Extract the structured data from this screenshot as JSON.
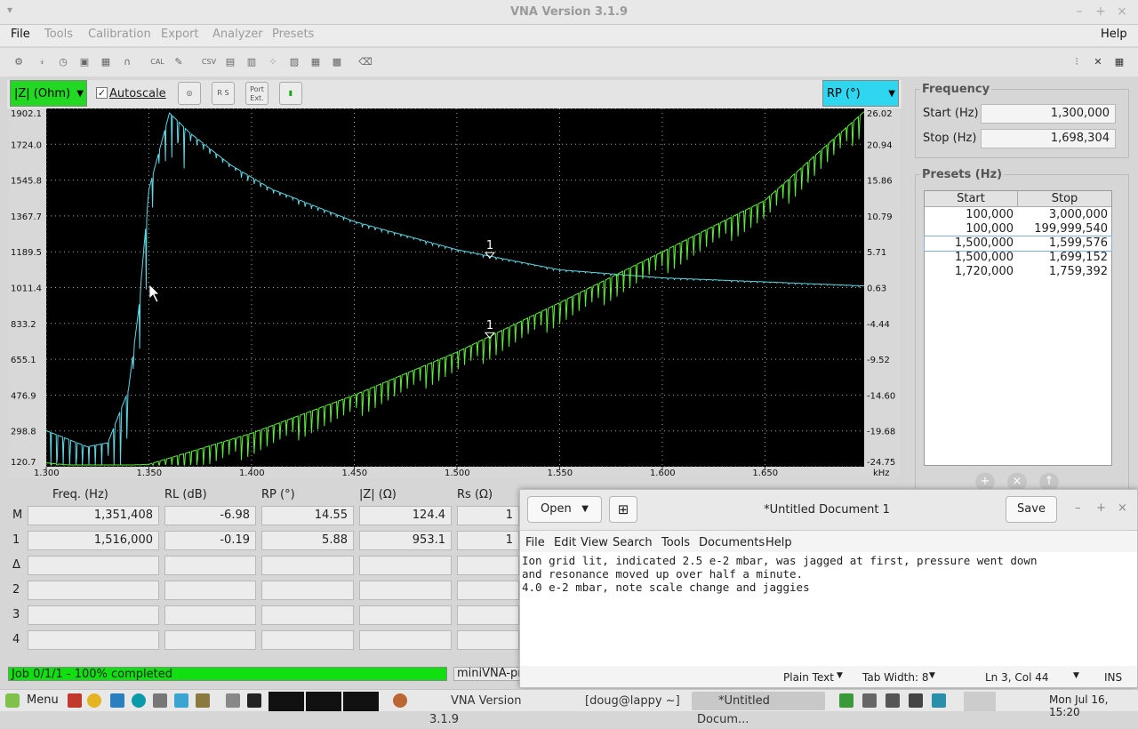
{
  "window": {
    "title": "VNA Version 3.1.9",
    "min": "–",
    "max": "+",
    "close": "×",
    "menu_icon": "▾"
  },
  "menu": {
    "file": "File",
    "tools": "Tools",
    "calibration": "Calibration",
    "export": "Export",
    "analyzer": "Analyzer",
    "presets": "Presets",
    "help": "Help"
  },
  "toolbar": {
    "cal": "CAL",
    "csv": "CSV"
  },
  "controls": {
    "left_scale": "|Z| (Ohm)",
    "autoscale": "Autoscale",
    "right_scale": "RP (°)",
    "port_ext": "Port Ext.",
    "r_s": "R S"
  },
  "chart": {
    "left_ticks": [
      "1902.1",
      "1724.0",
      "1545.8",
      "1367.7",
      "1189.5",
      "1011.4",
      "833.2",
      "655.1",
      "476.9",
      "298.8",
      "120.7"
    ],
    "right_ticks": [
      "26.02",
      "20.94",
      "15.86",
      "10.79",
      "5.71",
      "0.63",
      "-4.44",
      "-9.52",
      "-14.60",
      "-19.68",
      "-24.75"
    ],
    "x_ticks": [
      "1.300",
      "1.350",
      "1.400",
      "1.450",
      "1.500",
      "1.550",
      "1.600",
      "1.650"
    ],
    "x_unit": "kHz",
    "marker_label": "1"
  },
  "chart_data": {
    "type": "line",
    "x_unit": "kHz",
    "xlim": [
      1.3,
      1.698304
    ],
    "ylim_left": [
      120.7,
      1902.1
    ],
    "ylim_right": [
      -24.75,
      26.02
    ],
    "series": [
      {
        "name": "|Z| (Ohm)",
        "color": "#5fd8e6",
        "x": [
          1.3,
          1.32,
          1.33,
          1.34,
          1.345,
          1.35,
          1.36,
          1.37,
          1.39,
          1.41,
          1.45,
          1.5,
          1.55,
          1.6,
          1.65,
          1.698
        ],
        "y": [
          300,
          220,
          240,
          500,
          900,
          1500,
          1880,
          1780,
          1620,
          1500,
          1340,
          1200,
          1100,
          1060,
          1040,
          1020
        ]
      },
      {
        "name": "RP (°)",
        "color": "#5ef036",
        "x": [
          1.3,
          1.32,
          1.35,
          1.4,
          1.45,
          1.5,
          1.55,
          1.6,
          1.65,
          1.698
        ],
        "y": [
          -24.2,
          -24.75,
          -24.4,
          -20,
          -14.6,
          -8.5,
          -1.5,
          5.71,
          13,
          25.5
        ]
      }
    ]
  },
  "frequency": {
    "heading": "Frequency",
    "start_label": "Start (Hz)",
    "start": "1,300,000",
    "stop_label": "Stop (Hz)",
    "stop": "1,698,304"
  },
  "presets": {
    "heading": "Presets (Hz)",
    "col_start": "Start",
    "col_stop": "Stop",
    "rows": [
      {
        "start": "100,000",
        "stop": "3,000,000"
      },
      {
        "start": "100,000",
        "stop": "199,999,540"
      },
      {
        "start": "1,500,000",
        "stop": "1,599,576"
      },
      {
        "start": "1,500,000",
        "stop": "1,699,152"
      },
      {
        "start": "1,720,000",
        "stop": "1,759,392"
      }
    ]
  },
  "markers": {
    "headers": [
      "Freq. (Hz)",
      "RL (dB)",
      "RP (°)",
      "|Z| (Ω)",
      "Rs (Ω)"
    ],
    "rows": [
      {
        "label": "M",
        "freq": "1,351,408",
        "rl": "-6.98",
        "rp": "14.55",
        "z": "124.4",
        "rs": "1"
      },
      {
        "label": "1",
        "freq": "1,516,000",
        "rl": "-0.19",
        "rp": "5.88",
        "z": "953.1",
        "rs": "1"
      },
      {
        "label": "Δ",
        "freq": "",
        "rl": "",
        "rp": "",
        "z": "",
        "rs": ""
      },
      {
        "label": "2",
        "freq": "",
        "rl": "",
        "rp": "",
        "z": "",
        "rs": ""
      },
      {
        "label": "3",
        "freq": "",
        "rl": "",
        "rp": "",
        "z": "",
        "rs": ""
      },
      {
        "label": "4",
        "freq": "",
        "rl": "",
        "rp": "",
        "z": "",
        "rs": ""
      }
    ]
  },
  "status": {
    "job": "Job 0/1/1 - 100% completed",
    "device": "miniVNA-pro",
    "progress": 1.0
  },
  "gedit": {
    "open": "Open",
    "title": "*Untitled Document 1",
    "save": "Save",
    "min": "–",
    "max": "+",
    "close": "×",
    "menus": [
      "File",
      "Edit",
      "View",
      "Search",
      "Tools",
      "Documents",
      "Help"
    ],
    "lines": [
      "Ion grid lit, indicated 2.5 e-2 mbar, was jagged at first, pressure went down",
      "and resonance moved up over half a minute.",
      "4.0 e-2 mbar, note scale change and jaggies"
    ],
    "mode": "Plain Text",
    "tab_width": "Tab Width: 8",
    "position": "Ln 3, Col 44",
    "ins": "INS"
  },
  "taskbar": {
    "menu": "Menu",
    "tasks": [
      "VNA Version 3.1.9",
      "[doug@lappy ~]",
      "*Untitled Docum..."
    ],
    "clock": "Mon Jul 16, 15:20"
  }
}
